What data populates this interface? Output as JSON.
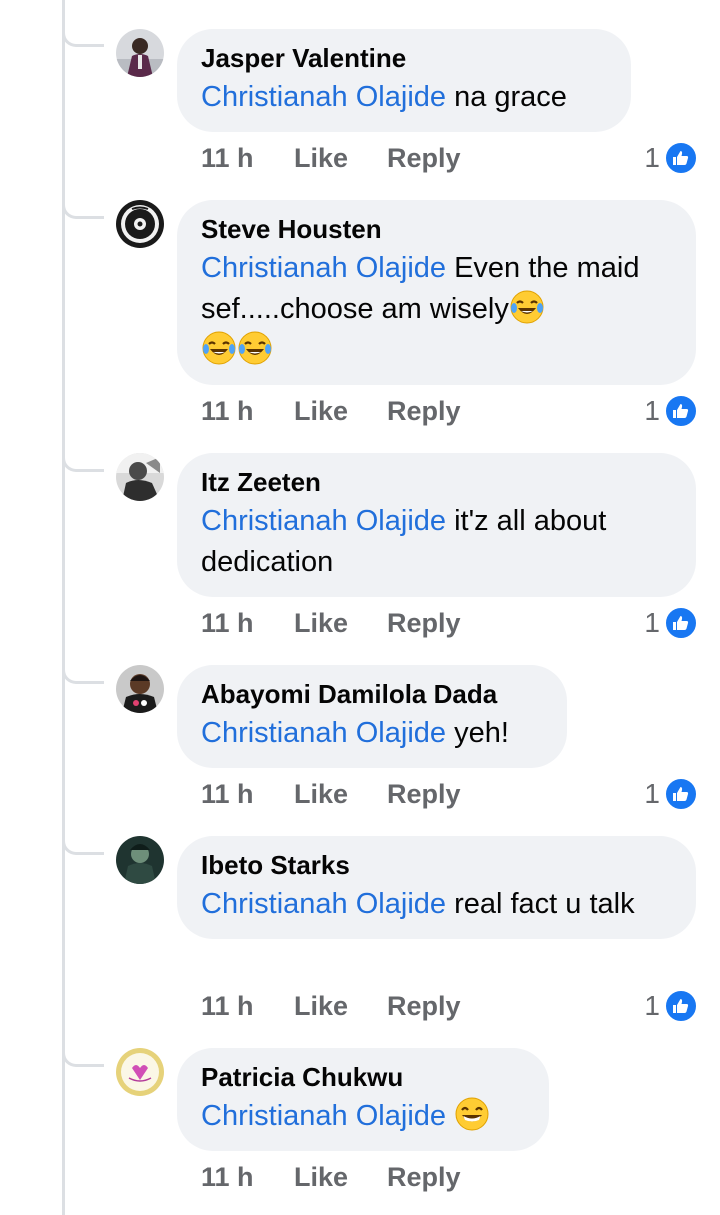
{
  "comments": [
    {
      "author": "Jasper Valentine",
      "mention": "Christianah Olajide",
      "text": " na grace",
      "time": "11 h",
      "like_label": "Like",
      "reply_label": "Reply",
      "reaction_count": "1",
      "reaction_icon": "thumbs-up-icon",
      "emojis": []
    },
    {
      "author": "Steve Housten",
      "mention": "Christianah Olajide",
      "text": " Even the maid sef.....choose am wisely",
      "time": "11 h",
      "like_label": "Like",
      "reply_label": "Reply",
      "reaction_count": "1",
      "reaction_icon": "thumbs-up-icon",
      "emojis": [
        "face-with-tears-of-joy",
        "face-with-tears-of-joy",
        "face-with-tears-of-joy"
      ]
    },
    {
      "author": "Itz Zeeten",
      "mention": "Christianah Olajide",
      "text": " it'z all about dedication",
      "time": "11 h",
      "like_label": "Like",
      "reply_label": "Reply",
      "reaction_count": "1",
      "reaction_icon": "thumbs-up-icon",
      "emojis": []
    },
    {
      "author": "Abayomi Damilola Dada",
      "mention": "Christianah Olajide",
      "text": " yeh!",
      "time": "11 h",
      "like_label": "Like",
      "reply_label": "Reply",
      "reaction_count": "1",
      "reaction_icon": "thumbs-up-icon",
      "emojis": []
    },
    {
      "author": "Ibeto Starks",
      "mention": "Christianah Olajide",
      "text": " real fact u talk",
      "time": "11 h",
      "like_label": "Like",
      "reply_label": "Reply",
      "reaction_count": "1",
      "reaction_icon": "thumbs-up-icon",
      "emojis": []
    },
    {
      "author": "Patricia Chukwu",
      "mention": "Christianah Olajide",
      "text": " ",
      "time": "11 h",
      "like_label": "Like",
      "reply_label": "Reply",
      "reaction_count": "",
      "emojis": [
        "grinning-face-with-smiling-eyes"
      ]
    }
  ],
  "colors": {
    "mention": "#216fdb",
    "bubble": "#f0f2f5",
    "meta": "#65676b",
    "like_badge": "#1877f2"
  }
}
